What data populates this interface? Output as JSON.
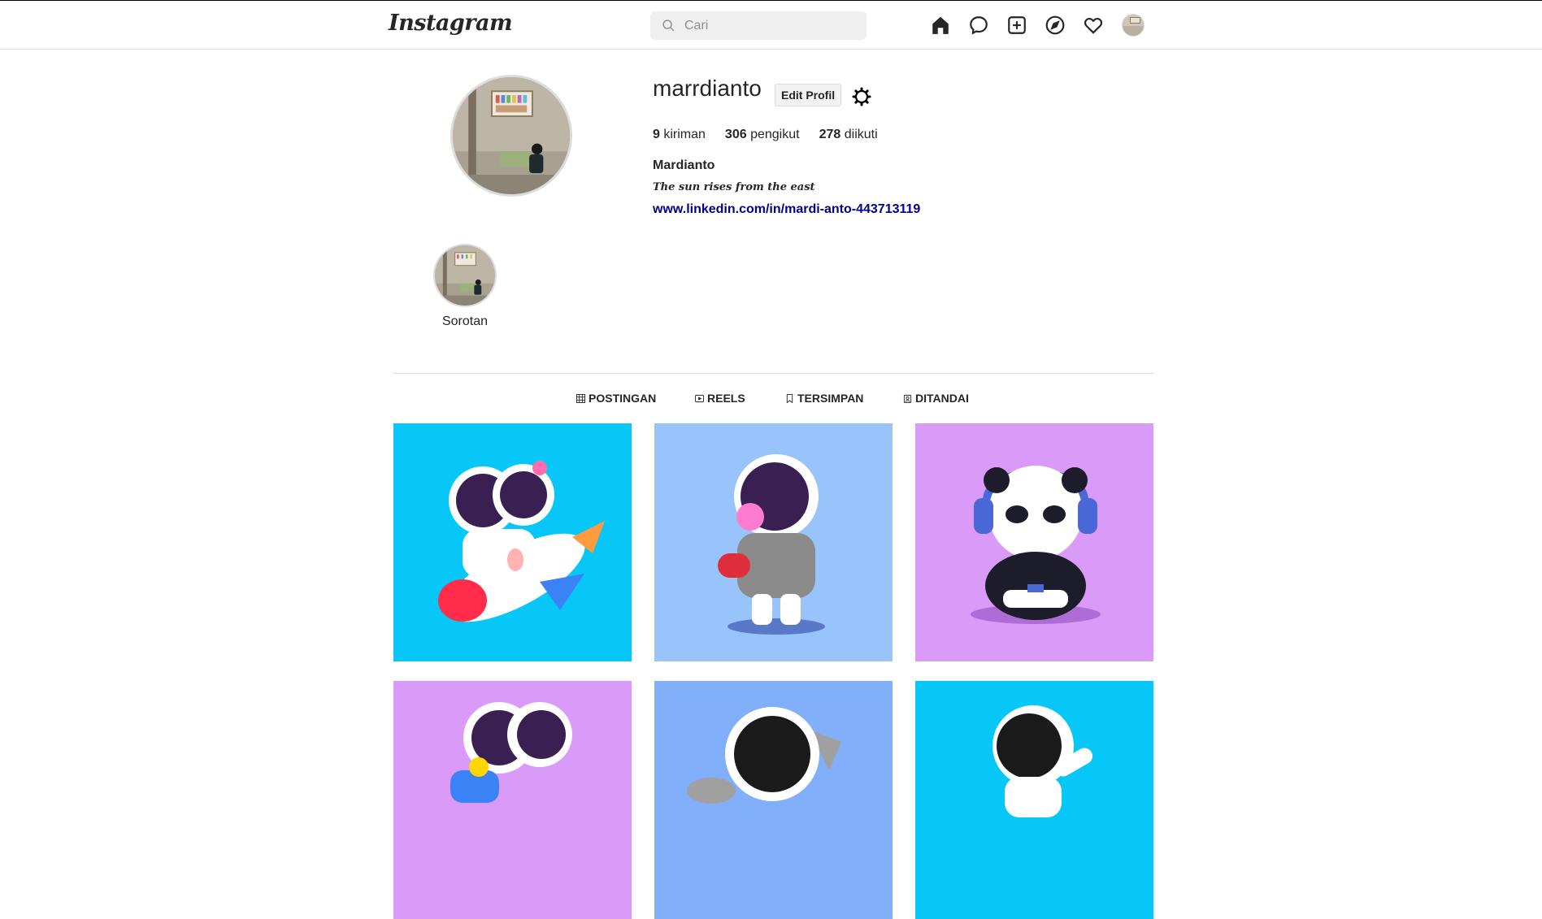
{
  "nav": {
    "logo": "Instagram",
    "search_placeholder": "Cari"
  },
  "profile": {
    "username": "marrdianto",
    "edit_label": "Edit Profil",
    "stats": [
      {
        "count": "9",
        "label": "kiriman"
      },
      {
        "count": "306",
        "label": "pengikut"
      },
      {
        "count": "278",
        "label": "diikuti"
      }
    ],
    "full_name": "Mardianto",
    "bio": "The sun rises from the east",
    "link": "www.linkedin.com/in/mardi-anto-443713119"
  },
  "highlights": [
    {
      "label": "Sorotan"
    }
  ],
  "tabs": [
    {
      "label": "POSTINGAN",
      "icon": "grid-icon"
    },
    {
      "label": "REELS",
      "icon": "reels-icon"
    },
    {
      "label": "TERSIMPAN",
      "icon": "bookmark-icon"
    },
    {
      "label": "DITANDAI",
      "icon": "tag-icon"
    }
  ],
  "posts": [
    {
      "name": "astronaut-couple-rocket",
      "bg": "#06c7f8"
    },
    {
      "name": "astronaut-bubblegum-skateboard",
      "bg": "#99c4fb"
    },
    {
      "name": "panda-gamer-headphones",
      "bg": "#d99af8"
    },
    {
      "name": "astronaut-couple-scooter",
      "bg": "#d99af8"
    },
    {
      "name": "astronaut-wrench",
      "bg": "#81aff9"
    },
    {
      "name": "astronaut-dab",
      "bg": "#06c7f8"
    }
  ],
  "colors": {
    "link": "#00008b",
    "border": "#dbdbdb",
    "search_bg": "#efefef"
  }
}
